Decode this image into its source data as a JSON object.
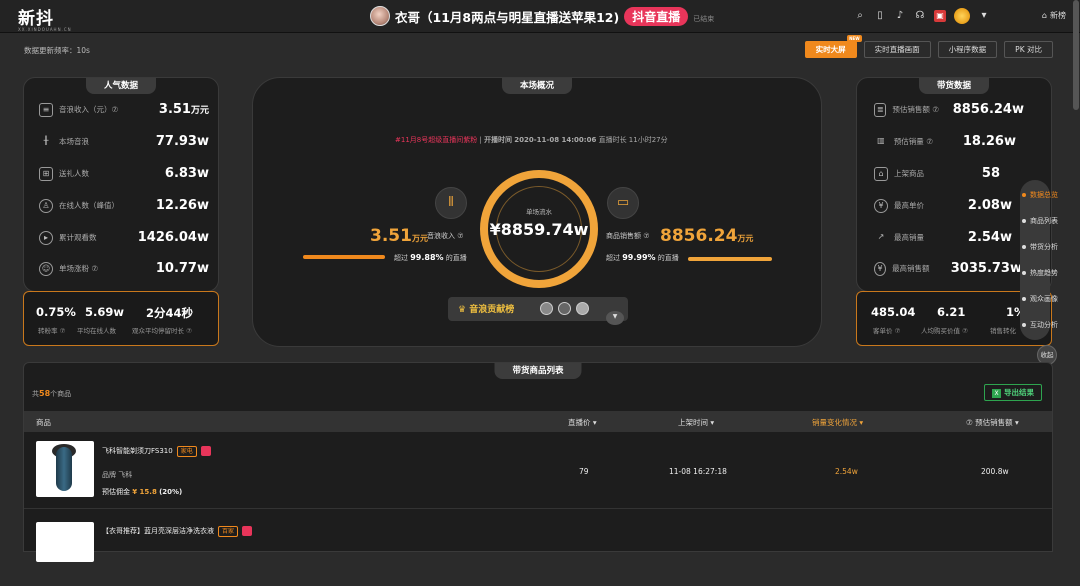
{
  "header": {
    "logo": "新抖",
    "logo_sub": "XX.XINDOUAHN.CN",
    "live_title": "衣哥（11月8两点与明星直播送苹果12)",
    "platform_badge": "抖音直播",
    "status": "已结束",
    "newest_label": "新榜"
  },
  "toolbar": {
    "update_freq": "数据更新频率：10s",
    "buttons": [
      "实时大屏",
      "实时直播画面",
      "小程序数据",
      "PK 对比"
    ],
    "new_tag": "NEW"
  },
  "popularity": {
    "title": "人气数据",
    "items": [
      {
        "label": "音浪收入（元）⑦",
        "value": "3.51",
        "unit": "万元"
      },
      {
        "label": "本场音浪",
        "value": "77.93w",
        "unit": ""
      },
      {
        "label": "送礼人数",
        "value": "6.83w",
        "unit": ""
      },
      {
        "label": "在线人数（峰值）",
        "value": "12.26w",
        "unit": ""
      },
      {
        "label": "累计观看数",
        "value": "1426.04w",
        "unit": ""
      },
      {
        "label": "单场涨粉 ⑦",
        "value": "10.77w",
        "unit": ""
      }
    ],
    "sub": [
      {
        "value": "0.75%",
        "label": "转粉率 ⑦"
      },
      {
        "value": "5.69w",
        "label": "平均在线人数"
      },
      {
        "value": "2分44秒",
        "label": "观众平均停留时长 ⑦"
      }
    ]
  },
  "overview": {
    "title": "本场概况",
    "tag": "#11月8号超级直播间紫粉",
    "start_label": "开播时间",
    "start_time": "2020-11-08 14:00:06",
    "duration": "直播时长 11小时27分",
    "ring_label": "单场流水",
    "ring_value": "¥8859.74w",
    "left_value": "3.51",
    "left_unit": "万元",
    "left_label": "音浪收入 ⑦",
    "left_beat_prefix": "超过",
    "left_beat": "99.88%",
    "left_beat_suffix": "的直播",
    "right_label": "商品销售额 ⑦",
    "right_value": "8856.24",
    "right_unit": "万元",
    "right_beat_prefix": "超过",
    "right_beat": "99.99%",
    "right_beat_suffix": "的直播",
    "gift_rank": "音浪贡献榜",
    "left_progress": 0.9988,
    "right_progress": 0.9999
  },
  "sales": {
    "title": "带货数据",
    "items": [
      {
        "label": "预估销售额 ⑦",
        "value": "8856.24w"
      },
      {
        "label": "预估销量 ⑦",
        "value": "18.26w"
      },
      {
        "label": "上架商品",
        "value": "58"
      },
      {
        "label": "最高单价",
        "value": "2.08w"
      },
      {
        "label": "最高销量",
        "value": "2.54w"
      },
      {
        "label": "最高销售额",
        "value": "3035.73w"
      }
    ],
    "sub": [
      {
        "value": "485.04",
        "label": "客单价 ⑦"
      },
      {
        "value": "6.21",
        "label": "人均购买价值 ⑦"
      },
      {
        "value": "1%",
        "label": "销售转化"
      }
    ]
  },
  "float_nav": {
    "items": [
      "数据总览",
      "商品列表",
      "带货分析",
      "热度趋势",
      "观众画像",
      "互动分析"
    ],
    "active": 0,
    "collapse": "收起"
  },
  "product_list": {
    "title": "带货商品列表",
    "count_prefix": "共",
    "count": "58",
    "count_suffix": "个商品",
    "export": "导出结果",
    "columns": [
      "商品",
      "直播价 ▾",
      "上架时间 ▾",
      "销量变化情况 ▾",
      "⑦ 预估销售额 ▾"
    ],
    "rows": [
      {
        "name": "飞科智能剃须刀FS310",
        "tag": "家电",
        "brand": "品牌  飞科",
        "commission_label": "预估佣金",
        "commission": "¥ 15.8",
        "commission_rate": "(20%)",
        "price": "79",
        "time": "11-08 16:27:18",
        "sales_change": "2.54w",
        "revenue": "200.8w"
      },
      {
        "name": "【衣哥推荐】蓝月亮深层洁净洗衣液",
        "tag": "百家",
        "brand": "",
        "commission_label": "",
        "commission": "",
        "commission_rate": "",
        "price": "",
        "time": "",
        "sales_change": "",
        "revenue": ""
      }
    ]
  },
  "icons": {
    "search": "search-icon",
    "phone": "phone-icon",
    "tiktok": "tiktok-icon",
    "headset": "headset-icon",
    "gift": "gift-icon",
    "user": "user-icon",
    "home": "home-icon"
  },
  "colors": {
    "accent": "#f0891d",
    "ring": "#f0a43a",
    "live": "#e8355a",
    "export": "#2ea44f"
  }
}
